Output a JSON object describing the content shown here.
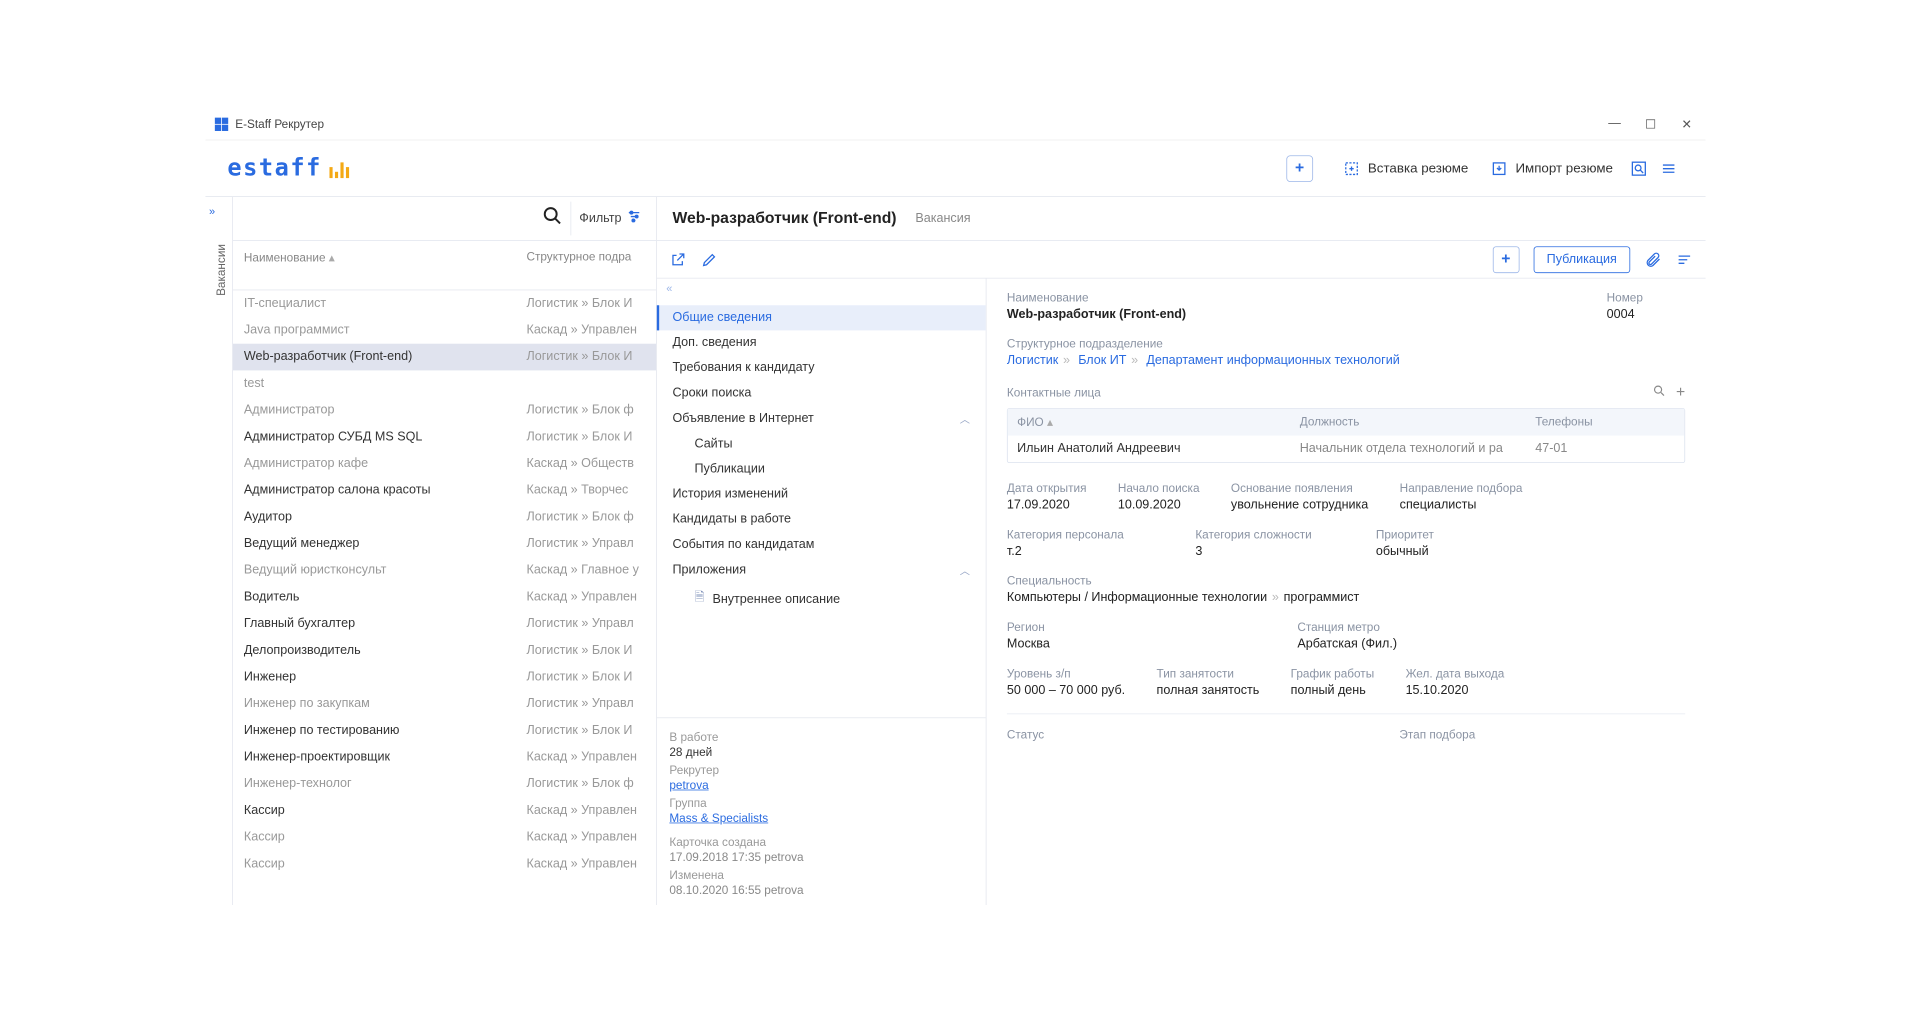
{
  "window": {
    "title": "E-Staff Рекрутер"
  },
  "topbar": {
    "logo_text": "estaff",
    "insert_resume": "Вставка резюме",
    "import_resume": "Импорт резюме"
  },
  "sidebar": {
    "tab_label": "Вакансии"
  },
  "list": {
    "filter_label": "Фильтр",
    "col_name": "Наименование",
    "col_dept": "Структурное подра",
    "rows": [
      {
        "name": "IT-специалист",
        "dept": "Логистик  »  Блок И",
        "dim": true
      },
      {
        "name": "Java программист",
        "dept": "Каскад  »  Управлен",
        "dim": true
      },
      {
        "name": "Web-разработчик (Front-end)",
        "dept": "Логистик  »  Блок И",
        "sel": true
      },
      {
        "name": "test",
        "dept": "",
        "dim": true
      },
      {
        "name": "Администратор",
        "dept": "Логистик  »  Блок ф",
        "dim": true
      },
      {
        "name": "Администратор СУБД MS SQL",
        "dept": "Логистик  »  Блок И"
      },
      {
        "name": "Администратор кафе",
        "dept": "Каскад  »  Обществ",
        "dim": true
      },
      {
        "name": "Администратор салона красоты",
        "dept": "Каскад  »  Творчес"
      },
      {
        "name": "Аудитор",
        "dept": "Логистик  »  Блок ф"
      },
      {
        "name": "Ведущий менеджер",
        "dept": "Логистик  »  Управл"
      },
      {
        "name": "Ведущий юристконсульт",
        "dept": "Каскад  »  Главное у",
        "dim": true
      },
      {
        "name": "Водитель",
        "dept": "Каскад  »  Управлен"
      },
      {
        "name": "Главный бухгалтер",
        "dept": "Логистик  »  Управл"
      },
      {
        "name": "Делопроизводитель",
        "dept": "Логистик  »  Блок И"
      },
      {
        "name": "Инженер",
        "dept": "Логистик  »  Блок И"
      },
      {
        "name": "Инженер по закупкам",
        "dept": "Логистик  »  Управл",
        "dim": true
      },
      {
        "name": "Инженер по тестированию",
        "dept": "Логистик  »  Блок И"
      },
      {
        "name": "Инженер-проектировщик",
        "dept": "Каскад  »  Управлен"
      },
      {
        "name": "Инженер-технолог",
        "dept": "Логистик  »  Блок ф",
        "dim": true
      },
      {
        "name": "Кассир",
        "dept": "Каскад  »  Управлен"
      },
      {
        "name": "Кассир",
        "dept": "Каскад  »  Управлен",
        "dim": true
      },
      {
        "name": "Кассир",
        "dept": "Каскад  »  Управлен",
        "dim": true
      }
    ]
  },
  "detail": {
    "title": "Web-разработчик (Front-end)",
    "subtitle": "Вакансия",
    "publish_btn": "Публикация",
    "nav": [
      {
        "label": "Общие сведения",
        "sel": true
      },
      {
        "label": "Доп. сведения"
      },
      {
        "label": "Требования к кандидату"
      },
      {
        "label": "Сроки поиска"
      },
      {
        "label": "Объявление в Интернет",
        "expand": true
      },
      {
        "label": "Сайты",
        "sub": true
      },
      {
        "label": "Публикации",
        "sub": true
      },
      {
        "label": "История изменений"
      },
      {
        "label": "Кандидаты в работе"
      },
      {
        "label": "События по кандидатам"
      },
      {
        "label": "Приложения",
        "expand": true
      },
      {
        "label": "Внутреннее описание",
        "sub": true,
        "icon": "doc"
      }
    ],
    "meta": {
      "in_work_l": "В работе",
      "in_work_v": "28 дней",
      "recruiter_l": "Рекрутер",
      "recruiter_v": "petrova",
      "group_l": "Группа",
      "group_v": "Mass & Specialists",
      "created_l": "Карточка создана",
      "created_v": "17.09.2018  17:35   petrova",
      "modified_l": "Изменена",
      "modified_v": "08.10.2020  16:55   petrova"
    }
  },
  "info": {
    "name_l": "Наименование",
    "name_v": "Web-разработчик (Front-end)",
    "num_l": "Номер",
    "num_v": "0004",
    "dept_l": "Структурное подразделение",
    "dept_path": [
      "Логистик",
      "Блок ИТ",
      "Департамент информационных технологий"
    ],
    "contacts_l": "Контактные лица",
    "ct_cols": {
      "fio": "ФИО",
      "pos": "Должность",
      "tel": "Телефоны"
    },
    "ct_row": {
      "fio": "Ильин Анатолий Андреевич",
      "pos": "Начальник отдела технологий и ра",
      "tel": "47-01"
    },
    "open_l": "Дата открытия",
    "open_v": "17.09.2020",
    "start_l": "Начало поиска",
    "start_v": "10.09.2020",
    "reason_l": "Основание появления",
    "reason_v": "увольнение сотрудника",
    "dir_l": "Направление подбора",
    "dir_v": "специалисты",
    "cat_l": "Категория персонала",
    "cat_v": "т.2",
    "compl_l": "Категория сложности",
    "compl_v": "3",
    "prio_l": "Приоритет",
    "prio_v": "обычный",
    "spec_l": "Специальность",
    "spec_v1": "Компьютеры / Информационные технологии",
    "spec_v2": "программист",
    "region_l": "Регион",
    "region_v": "Москва",
    "metro_l": "Станция метро",
    "metro_v": "Арбатская (Фил.)",
    "salary_l": "Уровень з/п",
    "salary_v": "50 000 – 70 000 руб.",
    "emp_l": "Тип занятости",
    "emp_v": "полная занятость",
    "sched_l": "График работы",
    "sched_v": "полный день",
    "date_out_l": "Жел. дата выхода",
    "date_out_v": "15.10.2020",
    "status_l": "Статус",
    "stage_l": "Этап подбора"
  }
}
